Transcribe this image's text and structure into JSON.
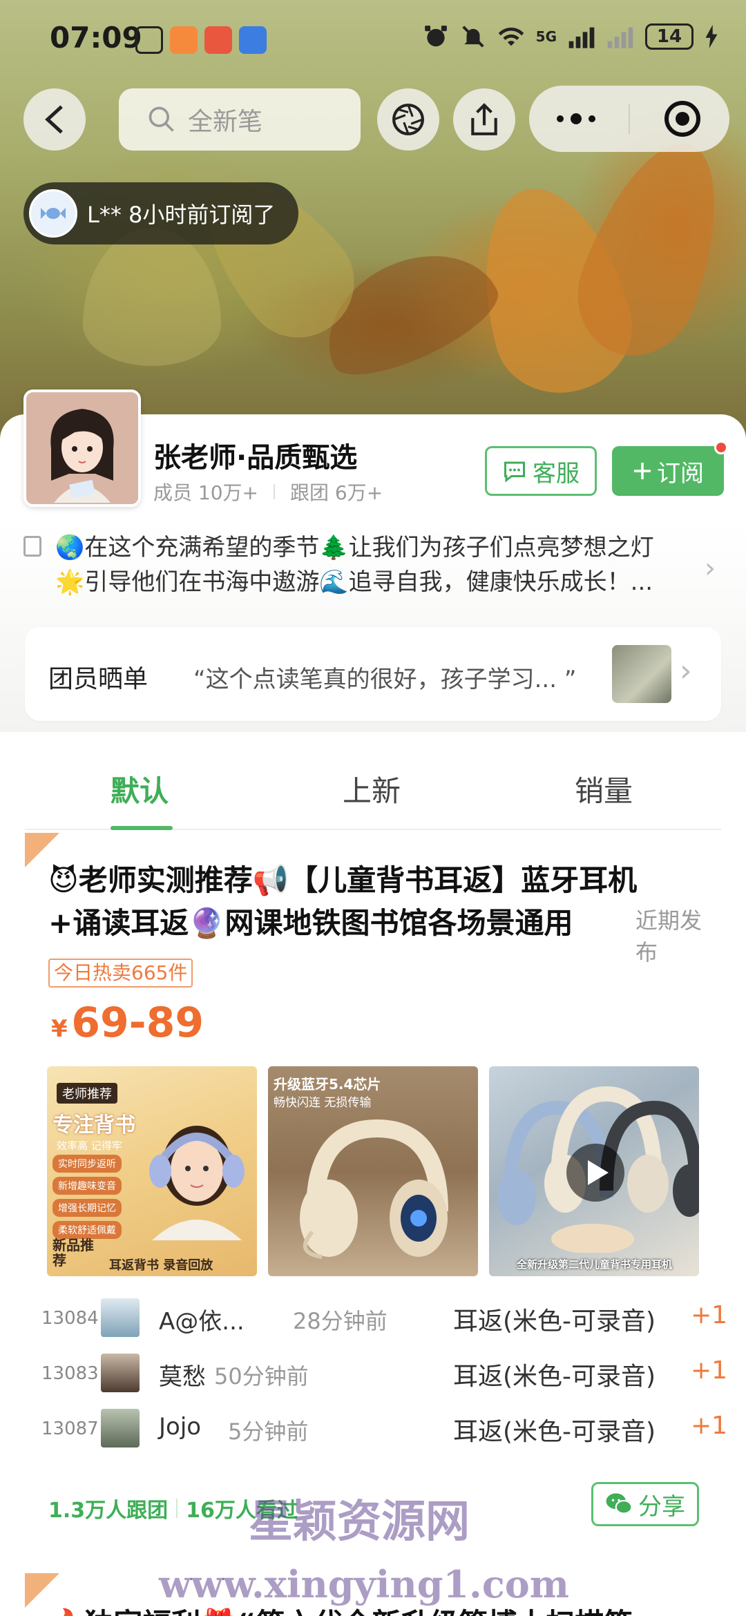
{
  "status_bar": {
    "time": "07:09",
    "battery": "14",
    "network": "5G"
  },
  "nav": {
    "search_placeholder": "全新笔"
  },
  "notice": {
    "text": "L** 8小时前订阅了"
  },
  "shop": {
    "name": "张老师·品质甄选",
    "members_label": "成员 10万+",
    "followers_label": "跟团 6万+",
    "service_button": "客服",
    "subscribe_button": "订阅",
    "intro_line1": "🌏在这个充满希望的季节🌲让我们为孩子们点亮梦想之灯",
    "intro_line2": "🌟引导他们在书海中遨游🌊追寻自我，健康快乐成长！..."
  },
  "review": {
    "label": "团员晒单",
    "quote": "“这个点读笔真的很好，孩子学习... ”"
  },
  "tabs": [
    "默认",
    "上新",
    "销量"
  ],
  "product": {
    "title_line1": "😈老师实测推荐📢【儿童背书耳返】蓝牙耳机",
    "title_line2": "+诵读耳返🔮网课地铁图书馆各场景通用",
    "recent_label": "近期发布",
    "hot_badge": "今日热卖665件",
    "currency": "¥",
    "price": "69-89",
    "image1": {
      "badge": "老师推荐",
      "headline": "专注背书",
      "sub": "效率高 记得牢",
      "features": [
        "实时同步返听",
        "新增趣味变音",
        "增强长期记忆",
        "柔软舒适佩戴"
      ],
      "corner": "新品推荐",
      "footer": "耳返背书 录音回放"
    },
    "image2": {
      "headline": "升级蓝牙5.4芯片",
      "sub": "畅快闪连 无损传输"
    },
    "image3": {
      "caption": "全新升级第二代儿童背书专用耳机"
    },
    "orders": [
      {
        "no": "13084",
        "name": "A@依...",
        "time": "28分钟前",
        "item": "耳返(米色-可录音)",
        "qty": "+1"
      },
      {
        "no": "13083",
        "name": "莫愁",
        "time": "50分钟前",
        "item": "耳返(米色-可录音)",
        "qty": "+1"
      },
      {
        "no": "13087",
        "name": "Jojo",
        "time": "5分钟前",
        "item": "耳返(米色-可录音)",
        "qty": "+1"
      }
    ],
    "stats_joined": "1.3万人跟团",
    "stats_viewed": "16万人看过",
    "share_button": "分享"
  },
  "next_product": {
    "title": "🔥独家福利🎁“第六代全新升级管博士扫描笔"
  },
  "watermark": {
    "line1": "星颖资源网",
    "line2": "www.xingying1.com"
  },
  "colors": {
    "brand_green": "#52b866",
    "price_orange": "#ee6d2f",
    "badge_red": "#f04c3e"
  }
}
